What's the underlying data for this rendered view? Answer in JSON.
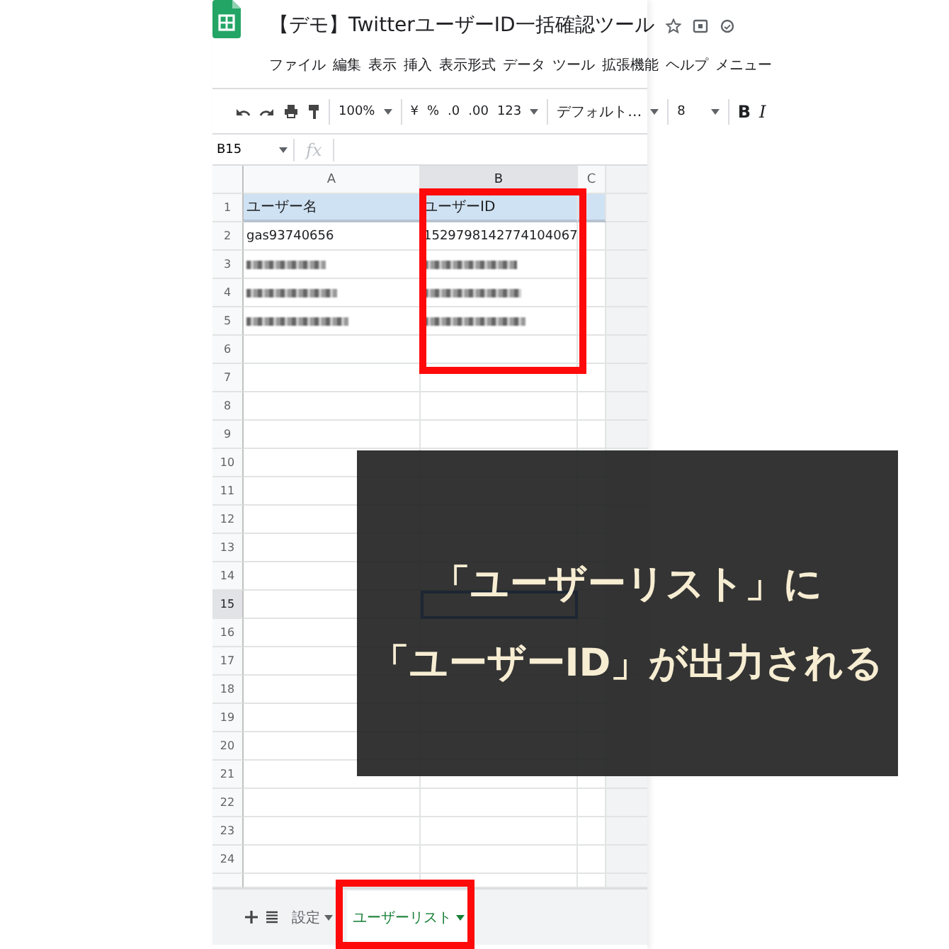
{
  "document": {
    "title": "【デモ】TwitterユーザーID一括確認ツール"
  },
  "menu": [
    "ファイル",
    "編集",
    "表示",
    "挿入",
    "表示形式",
    "データ",
    "ツール",
    "拡張機能",
    "ヘルプ",
    "メニュー"
  ],
  "toolbar": {
    "zoom": "100%",
    "currency": "¥",
    "percent": "%",
    "decrease_decimals": ".0",
    "increase_decimals": ".00",
    "number_format": "123",
    "font": "デフォルト…",
    "font_size": "8",
    "bold": "B",
    "italic": "I"
  },
  "formula_bar": {
    "cell_ref": "B15",
    "fx": "fx"
  },
  "columns": [
    {
      "label": "A",
      "selected": false
    },
    {
      "label": "B",
      "selected": true
    },
    {
      "label": "C",
      "selected": false
    }
  ],
  "rows": [
    {
      "number": "1",
      "kind": "header",
      "selected": false,
      "cells": [
        {
          "kind": "text",
          "text": "ユーザー名"
        },
        {
          "kind": "text",
          "text": "ユーザーID"
        }
      ]
    },
    {
      "number": "2",
      "kind": "data",
      "selected": false,
      "cells": [
        {
          "kind": "text",
          "text": "gas93740656"
        },
        {
          "kind": "text",
          "text": "1529798142774104067"
        }
      ]
    },
    {
      "number": "3",
      "kind": "data",
      "selected": false,
      "cells": [
        {
          "kind": "blurred"
        },
        {
          "kind": "blurred"
        }
      ]
    },
    {
      "number": "4",
      "kind": "data",
      "selected": false,
      "cells": [
        {
          "kind": "blurred"
        },
        {
          "kind": "blurred"
        }
      ]
    },
    {
      "number": "5",
      "kind": "data",
      "selected": false,
      "cells": [
        {
          "kind": "blurred"
        },
        {
          "kind": "blurred"
        }
      ]
    },
    {
      "number": "6",
      "kind": "data",
      "selected": false
    },
    {
      "number": "7",
      "kind": "data",
      "selected": false
    },
    {
      "number": "8",
      "kind": "data",
      "selected": false
    },
    {
      "number": "9",
      "kind": "data",
      "selected": false
    },
    {
      "number": "10",
      "kind": "data",
      "selected": false
    },
    {
      "number": "11",
      "kind": "data",
      "selected": false
    },
    {
      "number": "12",
      "kind": "data",
      "selected": false
    },
    {
      "number": "13",
      "kind": "data",
      "selected": false
    },
    {
      "number": "14",
      "kind": "data",
      "selected": false
    },
    {
      "number": "15",
      "kind": "data",
      "selected": true
    },
    {
      "number": "16",
      "kind": "data",
      "selected": false
    },
    {
      "number": "17",
      "kind": "data",
      "selected": false
    },
    {
      "number": "18",
      "kind": "data",
      "selected": false
    },
    {
      "number": "19",
      "kind": "data",
      "selected": false
    },
    {
      "number": "20",
      "kind": "data",
      "selected": false
    },
    {
      "number": "21",
      "kind": "data",
      "selected": false
    },
    {
      "number": "22",
      "kind": "data",
      "selected": false
    },
    {
      "number": "23",
      "kind": "data",
      "selected": false
    },
    {
      "number": "24",
      "kind": "data",
      "selected": false
    }
  ],
  "sheet_tabs": [
    {
      "label": "設定",
      "selected": false
    },
    {
      "label": "ユーザーリスト",
      "selected": true
    }
  ],
  "callout": {
    "lines": [
      "「ユーザーリスト」に",
      "「ユーザーID」が出力される"
    ]
  }
}
